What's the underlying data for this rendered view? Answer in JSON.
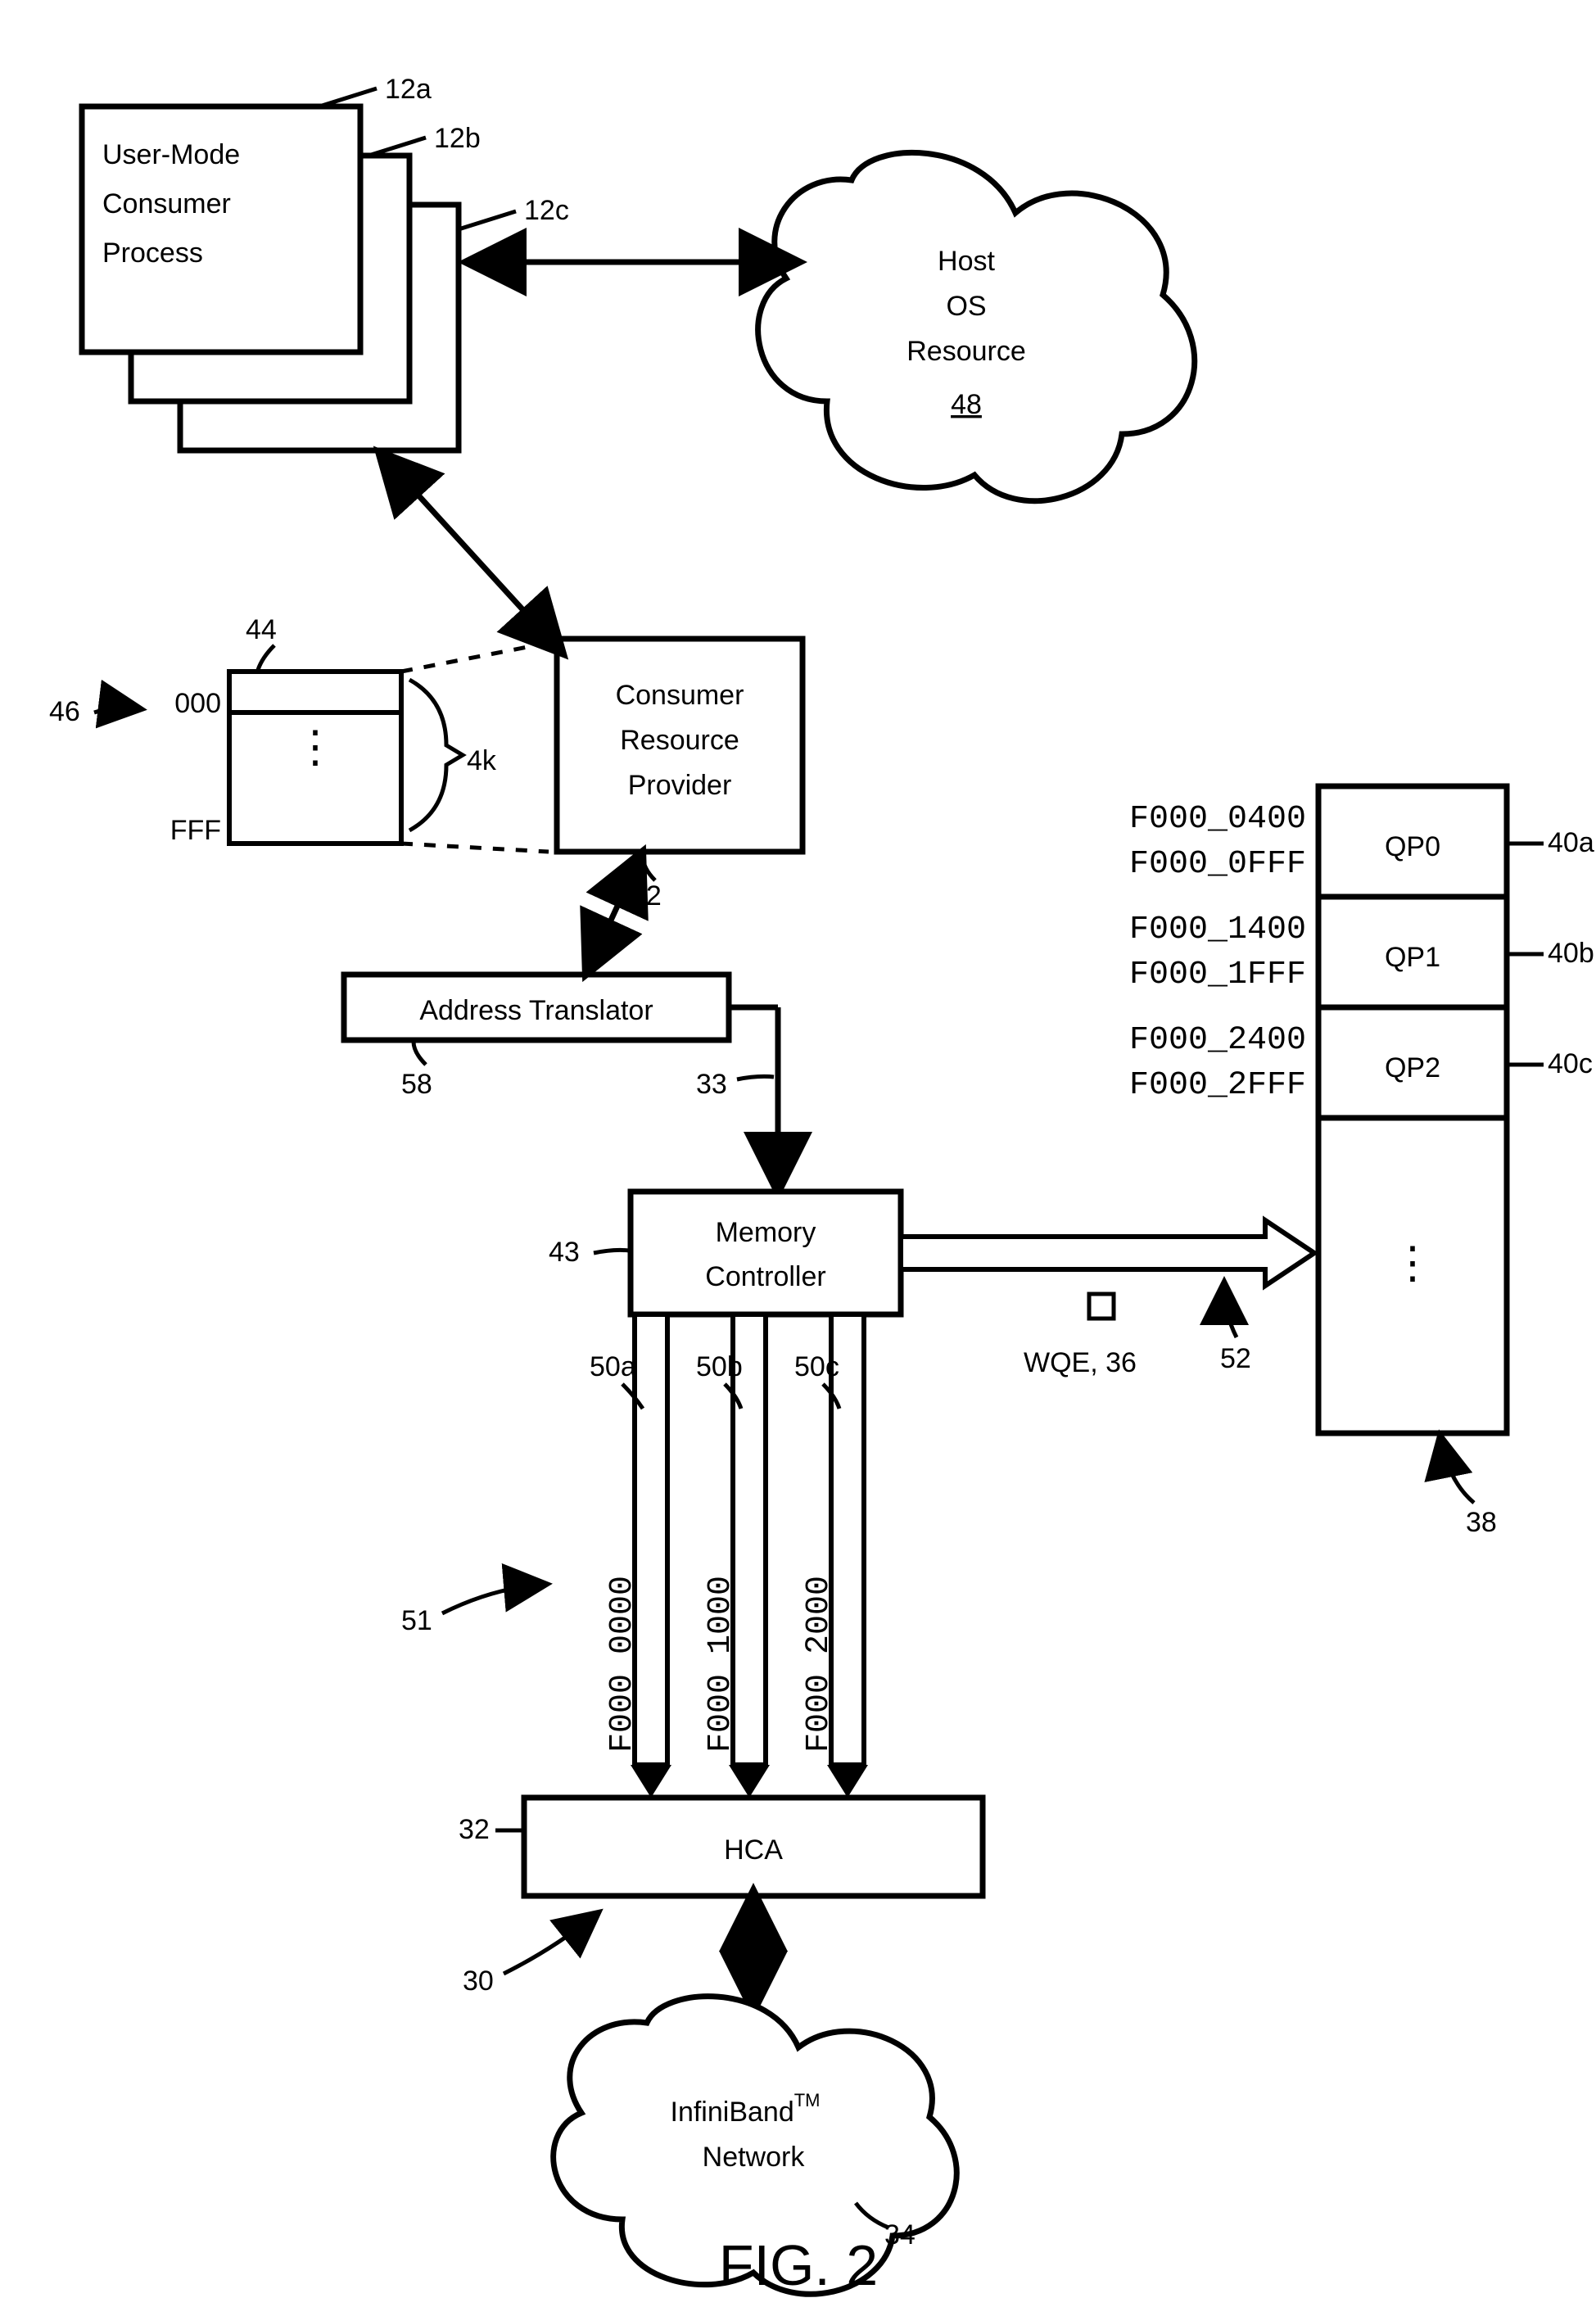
{
  "blocks": {
    "user_mode_consumer_process_l1": "User-Mode",
    "user_mode_consumer_process_l2": "Consumer",
    "user_mode_consumer_process_l3": "Process",
    "consumer_resource_provider_l1": "Consumer",
    "consumer_resource_provider_l2": "Resource",
    "consumer_resource_provider_l3": "Provider",
    "address_translator": "Address Translator",
    "memory_controller_l1": "Memory",
    "memory_controller_l2": "Controller",
    "hca": "HCA",
    "host_os_resource_l1": "Host",
    "host_os_resource_l2": "OS",
    "host_os_resource_l3": "Resource",
    "host_os_resource_ref": "48",
    "infiniband_network_l1": "InfiniBand",
    "infiniband_network_sup": "TM",
    "infiniband_network_l2": "Network"
  },
  "small_table": {
    "top": "000",
    "bot": "FFF",
    "size": "4k"
  },
  "queue_table": {
    "rows": [
      {
        "addr0": "F000_0400",
        "addr1": "F000_0FFF",
        "label": "QP0",
        "ref": "40a"
      },
      {
        "addr0": "F000_1400",
        "addr1": "F000_1FFF",
        "label": "QP1",
        "ref": "40b"
      },
      {
        "addr0": "F000_2400",
        "addr1": "F000_2FFF",
        "label": "QP2",
        "ref": "40c"
      }
    ]
  },
  "channel_addresses": [
    "F000_0000",
    "F000_1000",
    "F000_2000"
  ],
  "refs": {
    "r12a": "12a",
    "r12b": "12b",
    "r12c": "12c",
    "r44": "44",
    "r46": "46",
    "r42": "42",
    "r58": "58",
    "r33": "33",
    "r43": "43",
    "r50a": "50a",
    "r50b": "50b",
    "r50c": "50c",
    "r51": "51",
    "r52": "52",
    "r38": "38",
    "r32": "32",
    "r30": "30",
    "r34": "34",
    "wqe": "WQE, 36"
  },
  "figure": "FIG. 2"
}
